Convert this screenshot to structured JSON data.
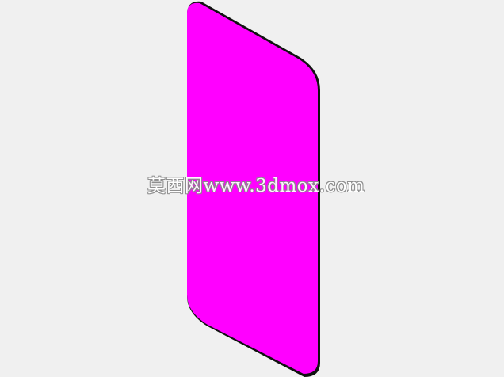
{
  "scene": {
    "background_color": "#f0f0f0",
    "panel_color": "#ff00ff",
    "panel_edge_color": "#111111",
    "shape": "rounded-parallelogram-panel"
  },
  "watermark": {
    "text": "莫西网www.3dmox.com"
  }
}
